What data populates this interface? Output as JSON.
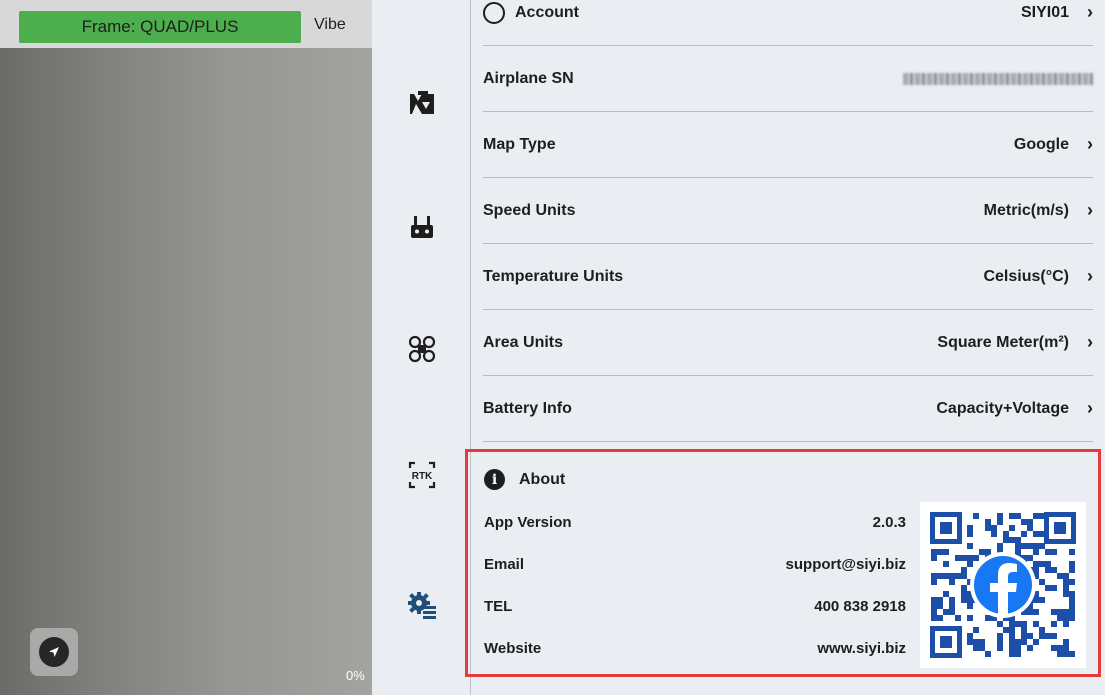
{
  "camera": {
    "frame_label": "Frame: QUAD/PLUS",
    "vibe_label": "Vibe",
    "percent": "0%"
  },
  "sidebar_icons": [
    "camera-icon",
    "remote-controller-icon",
    "drone-icon",
    "rtk-icon",
    "settings-gear-icon"
  ],
  "settings": {
    "partial_row": {
      "label": "Account",
      "value": "SIYI01"
    },
    "rows": [
      {
        "label": "Airplane SN",
        "value": ""
      },
      {
        "label": "Map Type",
        "value": "Google"
      },
      {
        "label": "Speed Units",
        "value": "Metric(m/s)"
      },
      {
        "label": "Temperature Units",
        "value": "Celsius(°C)"
      },
      {
        "label": "Area Units",
        "value": "Square Meter(m²)"
      },
      {
        "label": "Battery Info",
        "value": "Capacity+Voltage"
      }
    ]
  },
  "about": {
    "title": "About",
    "app_version_label": "App Version",
    "app_version": "2.0.3",
    "email_label": "Email",
    "email": "support@siyi.biz",
    "tel_label": "TEL",
    "tel": "400 838 2918",
    "website_label": "Website",
    "website": "www.siyi.biz"
  },
  "colors": {
    "frame_badge": "#4cae4c",
    "highlight_border": "#e43a3a",
    "facebook_blue": "#1877f2",
    "qr_blue": "#1d4fa8"
  }
}
